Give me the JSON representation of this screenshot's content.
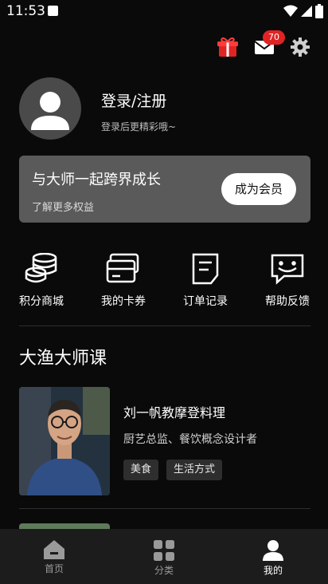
{
  "status_bar": {
    "time": "11:53"
  },
  "header": {
    "mail_badge": "70"
  },
  "profile": {
    "title": "登录/注册",
    "subtitle": "登录后更精彩哦~"
  },
  "member": {
    "title": "与大师一起跨界成长",
    "subtitle": "了解更多权益",
    "button": "成为会员"
  },
  "shortcuts": [
    {
      "label": "积分商城",
      "icon": "coins-icon"
    },
    {
      "label": "我的卡券",
      "icon": "card-icon"
    },
    {
      "label": "订单记录",
      "icon": "order-icon"
    },
    {
      "label": "帮助反馈",
      "icon": "feedback-icon"
    }
  ],
  "section": {
    "title": "大渔大师课"
  },
  "course": {
    "title": "刘一帆教摩登料理",
    "desc": "厨艺总监、餐饮概念设计者",
    "tags": [
      "美食",
      "生活方式"
    ]
  },
  "nav": [
    {
      "label": "首页",
      "icon": "home-icon"
    },
    {
      "label": "分类",
      "icon": "grid-icon"
    },
    {
      "label": "我的",
      "icon": "person-icon",
      "active": true
    }
  ],
  "colors": {
    "background": "#0a0a0a",
    "badge": "#e02424",
    "card": "#5a5a5a",
    "nav": "#1c1c1c"
  }
}
